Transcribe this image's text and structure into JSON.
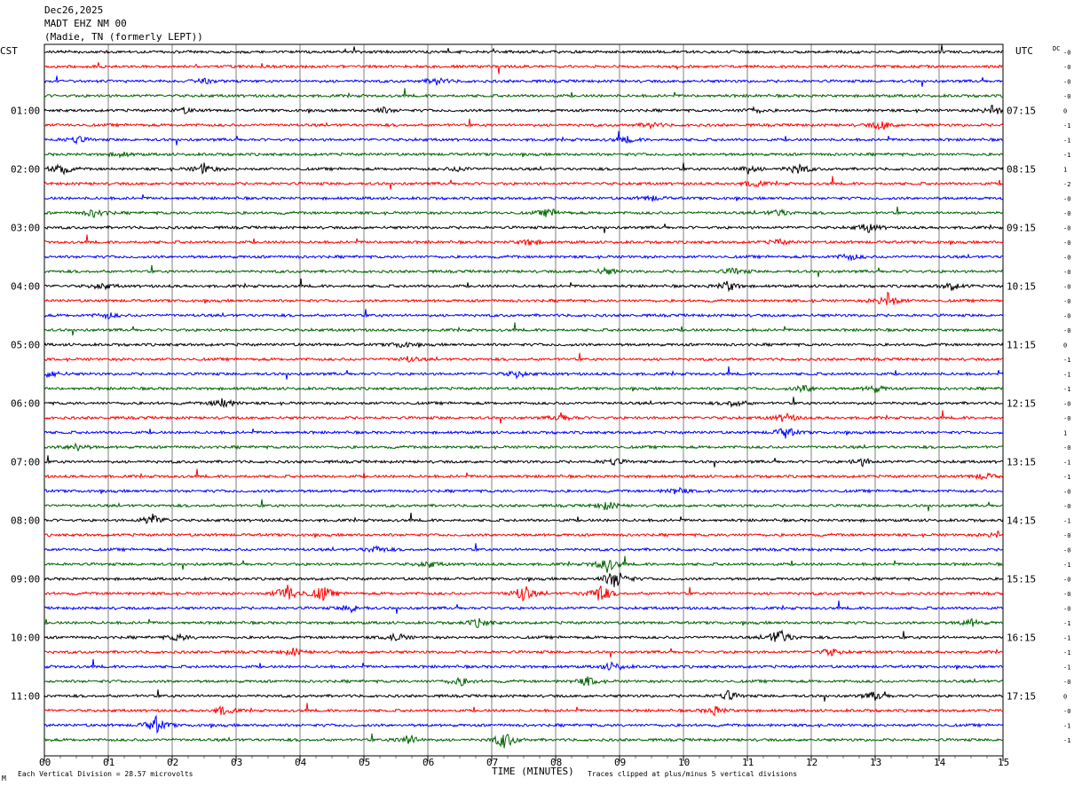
{
  "header": {
    "date": "Dec26,2025",
    "station": "MADT EHZ NM 00",
    "location": "(Madie, TN (formerly LEPT))"
  },
  "chart_data": {
    "type": "line",
    "subtype": "helicorder",
    "left_timezone": "CST",
    "right_timezone": "UTC",
    "xlabel": "TIME (MINUTES)",
    "x_ticks": [
      "00",
      "01",
      "02",
      "03",
      "04",
      "05",
      "06",
      "07",
      "08",
      "09",
      "10",
      "11",
      "12",
      "13",
      "14",
      "15"
    ],
    "xlim": [
      0,
      15
    ],
    "trace_minutes": 15,
    "trace_count": 48,
    "trace_colors": [
      "#000000",
      "#ff0000",
      "#0000ff",
      "#006400"
    ],
    "left_hour_labels": [
      "01:00",
      "02:00",
      "03:00",
      "04:00",
      "05:00",
      "06:00",
      "07:00",
      "08:00",
      "09:00",
      "10:00",
      "11:00"
    ],
    "right_hour_labels": [
      "07:15",
      "08:15",
      "09:15",
      "10:15",
      "11:15",
      "12:15",
      "13:15",
      "14:15",
      "15:15",
      "16:15",
      "17:15"
    ],
    "first_labeled_trace": 4,
    "dc_label": "DC",
    "dc_offsets": [
      "-0",
      "-0",
      "-0",
      "-0",
      "0",
      "-1",
      "-1",
      "-1",
      "1",
      "-2",
      "-0",
      "-0",
      "-0",
      "-0",
      "-0",
      "-0",
      "-0",
      "-0",
      "-0",
      "-0",
      "0",
      "-1",
      "-1",
      "-1",
      "-0",
      "-0",
      "1",
      "-0",
      "-1",
      "-1",
      "-0",
      "-0",
      "-1",
      "-0",
      "-0",
      "-1",
      "-0",
      "-0",
      "-0",
      "-1",
      "-1",
      "-1",
      "-1",
      "-0",
      "0",
      "-0",
      "-1",
      "-1"
    ],
    "bottom_left_note": "Each Vertical Division =   28.57 microvolts",
    "bottom_right_note": "Traces clipped at plus/minus 5 vertical divisions",
    "corner_mark": "M",
    "events": [
      {
        "trace": 2,
        "minute": 2.5,
        "amp": 2.5
      },
      {
        "trace": 2,
        "minute": 6.15,
        "amp": 4
      },
      {
        "trace": 4,
        "minute": 2.2,
        "amp": 3
      },
      {
        "trace": 4,
        "minute": 5.3,
        "amp": 3
      },
      {
        "trace": 4,
        "minute": 11.1,
        "amp": 3
      },
      {
        "trace": 4,
        "minute": 14.85,
        "amp": 6
      },
      {
        "trace": 5,
        "minute": 13.1,
        "amp": 5
      },
      {
        "trace": 5,
        "minute": 9.5,
        "amp": 3
      },
      {
        "trace": 6,
        "minute": 0.5,
        "amp": 4
      },
      {
        "trace": 6,
        "minute": 9.1,
        "amp": 3.5
      },
      {
        "trace": 7,
        "minute": 1.2,
        "amp": 3
      },
      {
        "trace": 8,
        "minute": 0.25,
        "amp": 7
      },
      {
        "trace": 8,
        "minute": 2.5,
        "amp": 6
      },
      {
        "trace": 8,
        "minute": 6.5,
        "amp": 3
      },
      {
        "trace": 8,
        "minute": 11.0,
        "amp": 5
      },
      {
        "trace": 8,
        "minute": 11.8,
        "amp": 6
      },
      {
        "trace": 9,
        "minute": 11.1,
        "amp": 4
      },
      {
        "trace": 10,
        "minute": 9.5,
        "amp": 3
      },
      {
        "trace": 11,
        "minute": 0.8,
        "amp": 5
      },
      {
        "trace": 11,
        "minute": 7.9,
        "amp": 5
      },
      {
        "trace": 11,
        "minute": 11.5,
        "amp": 4
      },
      {
        "trace": 12,
        "minute": 12.9,
        "amp": 5
      },
      {
        "trace": 13,
        "minute": 7.6,
        "amp": 4
      },
      {
        "trace": 13,
        "minute": 11.5,
        "amp": 3
      },
      {
        "trace": 14,
        "minute": 12.6,
        "amp": 4
      },
      {
        "trace": 15,
        "minute": 8.8,
        "amp": 4
      },
      {
        "trace": 15,
        "minute": 10.8,
        "amp": 4
      },
      {
        "trace": 16,
        "minute": 0.9,
        "amp": 4
      },
      {
        "trace": 16,
        "minute": 10.7,
        "amp": 6
      },
      {
        "trace": 16,
        "minute": 14.2,
        "amp": 4
      },
      {
        "trace": 17,
        "minute": 13.2,
        "amp": 9
      },
      {
        "trace": 18,
        "minute": 1.0,
        "amp": 3
      },
      {
        "trace": 20,
        "minute": 5.6,
        "amp": 3
      },
      {
        "trace": 21,
        "minute": 5.7,
        "amp": 3
      },
      {
        "trace": 22,
        "minute": 0.1,
        "amp": 4
      },
      {
        "trace": 22,
        "minute": 7.4,
        "amp": 4
      },
      {
        "trace": 23,
        "minute": 11.9,
        "amp": 4
      },
      {
        "trace": 23,
        "minute": 13.0,
        "amp": 4
      },
      {
        "trace": 24,
        "minute": 2.8,
        "amp": 6
      },
      {
        "trace": 24,
        "minute": 10.8,
        "amp": 4
      },
      {
        "trace": 25,
        "minute": 8.1,
        "amp": 4
      },
      {
        "trace": 25,
        "minute": 11.6,
        "amp": 5
      },
      {
        "trace": 26,
        "minute": 11.6,
        "amp": 6
      },
      {
        "trace": 27,
        "minute": 0.5,
        "amp": 4
      },
      {
        "trace": 28,
        "minute": 8.9,
        "amp": 4
      },
      {
        "trace": 28,
        "minute": 12.8,
        "amp": 4
      },
      {
        "trace": 29,
        "minute": 14.7,
        "amp": 4
      },
      {
        "trace": 30,
        "minute": 9.9,
        "amp": 4
      },
      {
        "trace": 31,
        "minute": 8.8,
        "amp": 5
      },
      {
        "trace": 32,
        "minute": 1.7,
        "amp": 7
      },
      {
        "trace": 33,
        "minute": 14.9,
        "amp": 4
      },
      {
        "trace": 34,
        "minute": 5.2,
        "amp": 4
      },
      {
        "trace": 35,
        "minute": 6.0,
        "amp": 4
      },
      {
        "trace": 35,
        "minute": 8.8,
        "amp": 9
      },
      {
        "trace": 36,
        "minute": 8.9,
        "amp": 7
      },
      {
        "trace": 36,
        "minute": 9.0,
        "amp": 5
      },
      {
        "trace": 37,
        "minute": 3.8,
        "amp": 11
      },
      {
        "trace": 37,
        "minute": 4.35,
        "amp": 9
      },
      {
        "trace": 37,
        "minute": 7.5,
        "amp": 10
      },
      {
        "trace": 37,
        "minute": 8.7,
        "amp": 11
      },
      {
        "trace": 38,
        "minute": 4.8,
        "amp": 4
      },
      {
        "trace": 39,
        "minute": 6.8,
        "amp": 5
      },
      {
        "trace": 39,
        "minute": 14.5,
        "amp": 4
      },
      {
        "trace": 40,
        "minute": 2.1,
        "amp": 4
      },
      {
        "trace": 40,
        "minute": 5.5,
        "amp": 5
      },
      {
        "trace": 40,
        "minute": 11.5,
        "amp": 10
      },
      {
        "trace": 41,
        "minute": 3.9,
        "amp": 4
      },
      {
        "trace": 41,
        "minute": 12.3,
        "amp": 4
      },
      {
        "trace": 42,
        "minute": 8.9,
        "amp": 5
      },
      {
        "trace": 43,
        "minute": 6.5,
        "amp": 5
      },
      {
        "trace": 43,
        "minute": 8.5,
        "amp": 5
      },
      {
        "trace": 44,
        "minute": 10.7,
        "amp": 5
      },
      {
        "trace": 44,
        "minute": 13.0,
        "amp": 5
      },
      {
        "trace": 45,
        "minute": 2.8,
        "amp": 5
      },
      {
        "trace": 45,
        "minute": 10.5,
        "amp": 5
      },
      {
        "trace": 46,
        "minute": 1.75,
        "amp": 9
      },
      {
        "trace": 47,
        "minute": 5.7,
        "amp": 6
      },
      {
        "trace": 47,
        "minute": 7.2,
        "amp": 10
      }
    ]
  }
}
